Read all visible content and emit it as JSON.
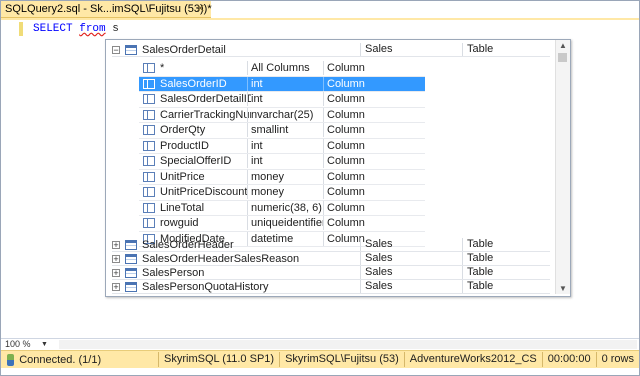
{
  "tab": {
    "title": "SQLQuery2.sql - Sk...imSQL\\Fujitsu (53))*",
    "close": "✕"
  },
  "editor": {
    "line1_kw1": "SELECT",
    "line1_kw2": "from",
    "line1_rest": " s"
  },
  "popup": {
    "expanded": {
      "name": "SalesOrderDetail",
      "schema": "Sales",
      "kind": "Table",
      "toggle": "−"
    },
    "columns": [
      {
        "name": "*",
        "type": "All Columns",
        "kind": "Column"
      },
      {
        "name": "SalesOrderID",
        "type": "int",
        "kind": "Column"
      },
      {
        "name": "SalesOrderDetailID",
        "type": "int",
        "kind": "Column"
      },
      {
        "name": "CarrierTrackingNumber",
        "type": "nvarchar(25)",
        "kind": "Column"
      },
      {
        "name": "OrderQty",
        "type": "smallint",
        "kind": "Column"
      },
      {
        "name": "ProductID",
        "type": "int",
        "kind": "Column"
      },
      {
        "name": "SpecialOfferID",
        "type": "int",
        "kind": "Column"
      },
      {
        "name": "UnitPrice",
        "type": "money",
        "kind": "Column"
      },
      {
        "name": "UnitPriceDiscount",
        "type": "money",
        "kind": "Column"
      },
      {
        "name": "LineTotal",
        "type": "numeric(38, 6)",
        "kind": "Column"
      },
      {
        "name": "rowguid",
        "type": "uniqueidentifier",
        "kind": "Column"
      },
      {
        "name": "ModifiedDate",
        "type": "datetime",
        "kind": "Column"
      }
    ],
    "selected_column": "SalesOrderID",
    "tables": [
      {
        "name": "SalesOrderHeader",
        "schema": "Sales",
        "kind": "Table",
        "toggle": "+"
      },
      {
        "name": "SalesOrderHeaderSalesReason",
        "schema": "Sales",
        "kind": "Table",
        "toggle": "+"
      },
      {
        "name": "SalesPerson",
        "schema": "Sales",
        "kind": "Table",
        "toggle": "+"
      },
      {
        "name": "SalesPersonQuotaHistory",
        "schema": "Sales",
        "kind": "Table",
        "toggle": "+"
      }
    ],
    "scroll_up": "▲",
    "scroll_down": "▼"
  },
  "zoom": {
    "value": "100 %",
    "dropdown": "▼"
  },
  "status": {
    "connection": "Connected. (1/1)",
    "server": "SkyrimSQL (11.0 SP1)",
    "login": "SkyrimSQL\\Fujitsu (53)",
    "database": "AdventureWorks2012_CS",
    "elapsed": "00:00:00",
    "rows": "0 rows"
  }
}
